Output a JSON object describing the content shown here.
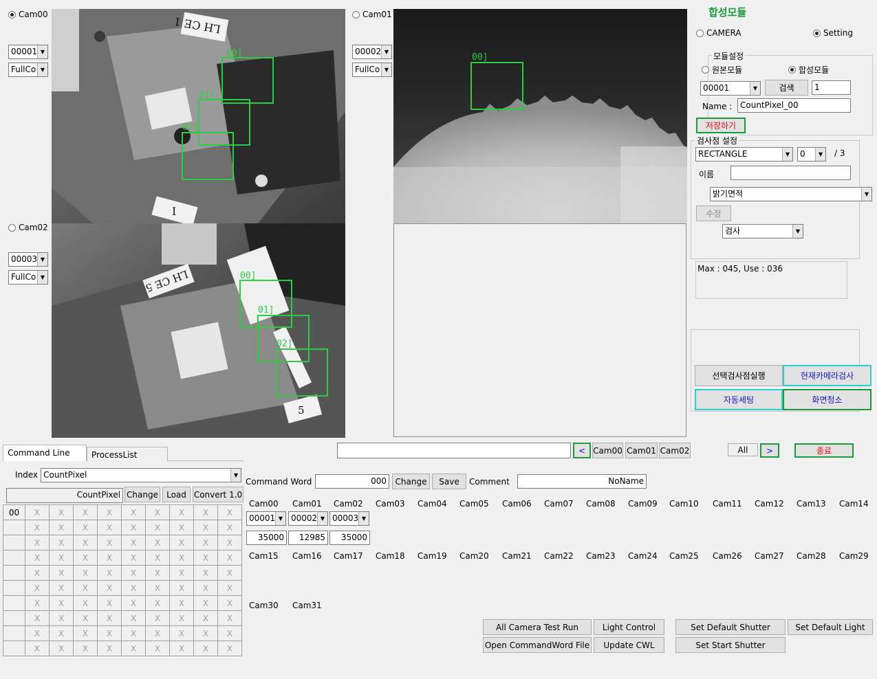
{
  "cam_views": {
    "cam00": {
      "label": "Cam00",
      "selected": true,
      "id_value": "00001",
      "mode_value": "FullCo",
      "rois": [
        "00]",
        "01]",
        "02]"
      ],
      "plate_text": "LH CE 1",
      "plate_text_2": "I"
    },
    "cam01": {
      "label": "Cam01",
      "selected": false,
      "id_value": "00002",
      "mode_value": "FullCo",
      "rois": [
        "00]"
      ]
    },
    "cam02": {
      "label": "Cam02",
      "selected": false,
      "id_value": "00003",
      "mode_value": "FullCo",
      "rois": [
        "00]",
        "01]",
        "02]"
      ],
      "plate_text": "LH CE 5",
      "plate_text_2": "5"
    }
  },
  "panel": {
    "title": "합성모듈",
    "mode_camera": "CAMERA",
    "mode_setting": "Setting",
    "module_group_title": "모듈설정",
    "radio_original": "원본모듈",
    "radio_composite": "합성모듈",
    "module_id": "00001",
    "search_button": "검색",
    "search_value": "1",
    "name_label": "Name :",
    "name_value": "CountPixel_00",
    "save_button": "저장하기",
    "inspect_group_title": "검사점 설정",
    "shape_value": "RECTANGLE",
    "index_value": "0",
    "index_total": "/ 3",
    "name_label_kr": "이름",
    "name_field_value": "",
    "algo_value": "밝기면적",
    "modify_button": "수정",
    "inspect_value": "검사",
    "status_text": "Max : 045, Use : 036",
    "run_selected_button": "선택검사점실행",
    "camera_inspect_button": "현재카메라검사",
    "auto_setting_button": "자동세팅",
    "clear_screen_button": "화면청소"
  },
  "command_bar": {
    "input_value": "",
    "prev_button": "<",
    "cam_buttons": [
      "Cam00",
      "Cam01",
      "Cam02"
    ],
    "all_button": "All",
    "next_button": ">",
    "exit_button": "종료"
  },
  "tabs": [
    "Command Line",
    "ProcessList"
  ],
  "command_line": {
    "index_label": "Index",
    "index_value": "CountPixel",
    "current_value": "CountPixel",
    "change_button": "Change",
    "load_button": "Load",
    "convert_button": "Convert 1.0",
    "row_first": "00",
    "cell_mark": "X"
  },
  "command_word": {
    "label": "Command Word",
    "value": "000",
    "change_button": "Change",
    "save_button": "Save",
    "comment_label": "Comment",
    "comment_value": "NoName"
  },
  "cameras": {
    "row1": [
      "Cam00",
      "Cam01",
      "Cam02",
      "Cam03",
      "Cam04",
      "Cam05",
      "Cam06",
      "Cam07",
      "Cam08",
      "Cam09",
      "Cam10",
      "Cam11",
      "Cam12",
      "Cam13",
      "Cam14"
    ],
    "row2": [
      "Cam15",
      "Cam16",
      "Cam17",
      "Cam18",
      "Cam19",
      "Cam20",
      "Cam21",
      "Cam22",
      "Cam23",
      "Cam24",
      "Cam25",
      "Cam26",
      "Cam27",
      "Cam28",
      "Cam29"
    ],
    "row3": [
      "Cam30",
      "Cam31"
    ],
    "ids": [
      "00001",
      "00002",
      "00003"
    ],
    "shutters": [
      "35000",
      "12985",
      "35000"
    ]
  },
  "bottom_buttons": {
    "all_camera_test_run": "All Camera Test Run",
    "light_control": "Light Control",
    "set_default_shutter": "Set Default Shutter",
    "set_default_light": "Set Default Light",
    "open_commandword_file": "Open CommandWord File",
    "update_cwl": "Update CWL",
    "set_start_shutter": "Set Start Shutter"
  },
  "colors": {
    "roi_green": "#2ecc40",
    "button_green_border": "#1a9a3a",
    "button_cyan_border": "#2ad0d0",
    "title_green": "#1a9a3a",
    "text_blue": "#1414c8",
    "text_red": "#e01010"
  }
}
